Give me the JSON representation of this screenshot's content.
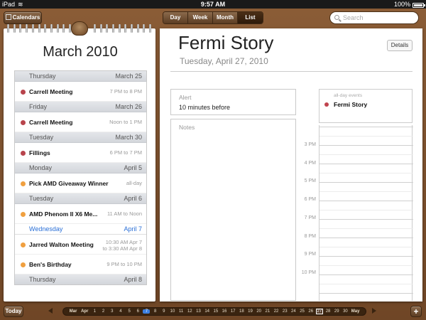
{
  "statusbar": {
    "device": "iPad",
    "time": "9:57 AM",
    "battery": "100%"
  },
  "toolbar": {
    "calendars_label": "Calendars",
    "views": [
      "Day",
      "Week",
      "Month",
      "List"
    ],
    "active_view": "List",
    "search_placeholder": "Search"
  },
  "left": {
    "month_title": "March 2010",
    "groups": [
      {
        "day": "Thursday",
        "date": "March 25",
        "events": [
          {
            "title": "Carrell Meeting",
            "time": "7 PM to 8 PM",
            "color": "#b8444c"
          }
        ]
      },
      {
        "day": "Friday",
        "date": "March 26",
        "events": [
          {
            "title": "Carrell Meeting",
            "time": "Noon to 1 PM",
            "color": "#b8444c"
          }
        ]
      },
      {
        "day": "Tuesday",
        "date": "March 30",
        "events": [
          {
            "title": "Fillings",
            "time": "6 PM to 7 PM",
            "color": "#b8444c"
          }
        ]
      },
      {
        "day": "Monday",
        "date": "April 5",
        "events": [
          {
            "title": "Pick AMD Giveaway Winner",
            "time": "all-day",
            "color": "#f0a040"
          }
        ]
      },
      {
        "day": "Tuesday",
        "date": "April 6",
        "events": [
          {
            "title": "AMD Phenom II X6 Me...",
            "time": "11 AM to Noon",
            "color": "#f0a040"
          }
        ]
      },
      {
        "day": "Wednesday",
        "date": "April 7",
        "today": true,
        "events": [
          {
            "title": "Jarred Walton Meeting",
            "time": "10:30 AM Apr 7",
            "time2": "to 3:30 AM Apr 8",
            "color": "#f0a040"
          },
          {
            "title": "Ben's Birthday",
            "time": "9 PM to 10 PM",
            "color": "#f0a040"
          }
        ]
      },
      {
        "day": "Thursday",
        "date": "April 8",
        "events": []
      }
    ]
  },
  "detail": {
    "title": "Fermi Story",
    "date": "Tuesday, April 27, 2010",
    "details_label": "Details",
    "alert_label": "Alert",
    "alert_value": "10 minutes before",
    "notes_label": "Notes",
    "allday_label": "all-day events",
    "allday_event": "Fermi Story",
    "allday_color": "#c0444e",
    "hours": [
      "3 PM",
      "4 PM",
      "5 PM",
      "6 PM",
      "7 PM",
      "8 PM",
      "9 PM",
      "10 PM"
    ]
  },
  "bottom": {
    "today_label": "Today",
    "plus_label": "+",
    "timeline": [
      "Mar",
      "Apr",
      "1",
      "2",
      "3",
      "4",
      "5",
      "6",
      "7",
      "8",
      "9",
      "10",
      "11",
      "12",
      "13",
      "14",
      "15",
      "16",
      "17",
      "18",
      "19",
      "20",
      "21",
      "22",
      "23",
      "24",
      "25",
      "26",
      "27",
      "28",
      "29",
      "30",
      "May"
    ],
    "timeline_today": "7",
    "timeline_selected": "27"
  }
}
